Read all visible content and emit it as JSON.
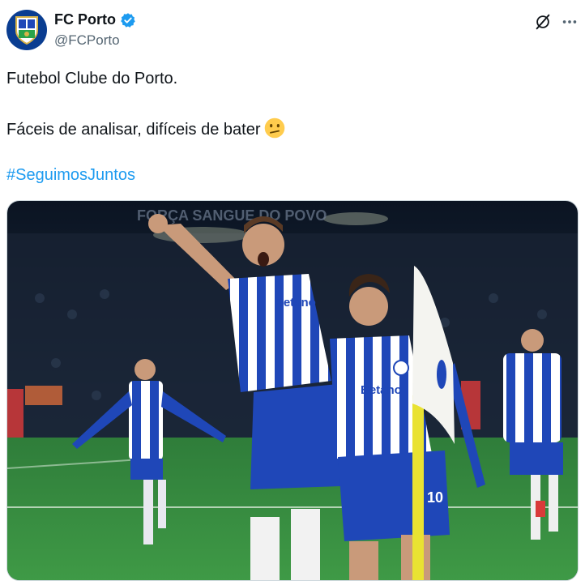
{
  "account": {
    "display_name": "FC Porto",
    "handle": "@FCPorto",
    "verified": true,
    "avatar_icon": "fc-porto-crest-icon"
  },
  "header_actions": [
    {
      "icon": "grok-icon"
    },
    {
      "icon": "more-options-icon"
    }
  ],
  "post": {
    "line1": "Futebol Clube do Porto.",
    "line2": "Fáceis de analisar, difíceis de bater",
    "line2_emoji": "confused-face-emoji",
    "hashtag": "#SeguimosJuntos"
  },
  "media": {
    "stadium_banner": "FORÇA SANGUE DO POVO",
    "sponsor": "Betano",
    "shirt_number": "10"
  },
  "colors": {
    "link": "#1d9bf0",
    "verified": "#1d9bf0",
    "secondary_text": "#536471",
    "porto_blue": "#1f47b8"
  }
}
